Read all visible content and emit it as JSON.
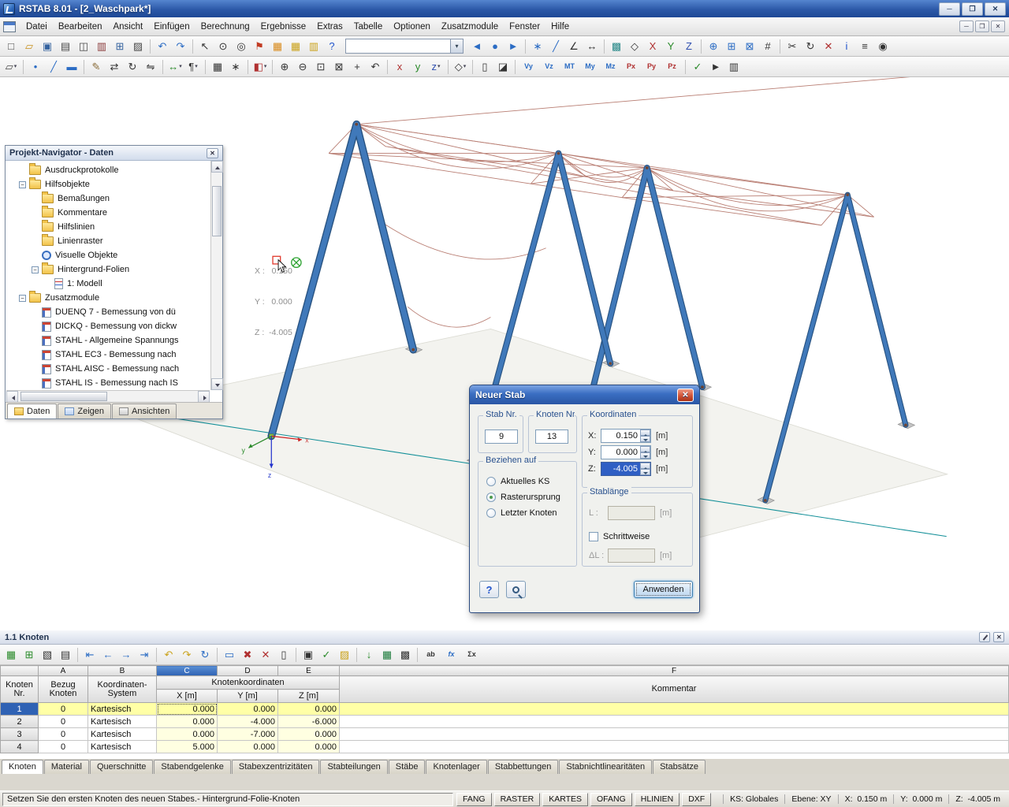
{
  "window": {
    "title": "RSTAB 8.01 - [2_Waschpark*]"
  },
  "menu": {
    "items": [
      "Datei",
      "Bearbeiten",
      "Ansicht",
      "Einfügen",
      "Berechnung",
      "Ergebnisse",
      "Extras",
      "Tabelle",
      "Optionen",
      "Zusatzmodule",
      "Fenster",
      "Hilfe"
    ]
  },
  "toolbar1": {
    "icons": [
      {
        "n": "new-file",
        "g": "□",
        "c": "#4a4a4a"
      },
      {
        "n": "open-project",
        "g": "▱",
        "c": "#c8901c"
      },
      {
        "n": "save",
        "g": "▣",
        "c": "#35639f"
      },
      {
        "n": "print",
        "g": "▤",
        "c": "#4a4a4a"
      },
      {
        "n": "print-preview",
        "g": "◫",
        "c": "#4a4a4a"
      },
      {
        "n": "export",
        "g": "▥",
        "c": "#8a3a3a"
      },
      {
        "n": "copy",
        "g": "⊞",
        "c": "#35639f"
      },
      {
        "n": "paste",
        "g": "▨",
        "c": "#4a4a4a"
      },
      {
        "t": "sep"
      },
      {
        "n": "undo",
        "g": "↶",
        "c": "#2b6cc4"
      },
      {
        "n": "redo",
        "g": "↷",
        "c": "#2b6cc4"
      },
      {
        "t": "sep"
      },
      {
        "n": "select-pointer",
        "g": "↖",
        "c": "#333333"
      },
      {
        "n": "zoom-region",
        "g": "⊙",
        "c": "#333333"
      },
      {
        "n": "magnifier",
        "g": "◎",
        "c": "#333333"
      },
      {
        "n": "flag-marker",
        "g": "⚑",
        "c": "#c23b22"
      },
      {
        "n": "project-navigator",
        "g": "▦",
        "c": "#d98a1a"
      },
      {
        "n": "table-manager",
        "g": "▦",
        "c": "#caa21a"
      },
      {
        "n": "mini-table",
        "g": "▥",
        "c": "#caa21a"
      },
      {
        "n": "help",
        "g": "?",
        "c": "#2255cc"
      },
      {
        "t": "combo"
      },
      {
        "n": "history-back",
        "g": "◄",
        "c": "#2b6cc4"
      },
      {
        "n": "history-current",
        "g": "●",
        "c": "#2b6cc4"
      },
      {
        "n": "history-forward",
        "g": "►",
        "c": "#2b6cc4"
      },
      {
        "t": "sep"
      },
      {
        "n": "insert-node",
        "g": "∗",
        "c": "#2b6cc4"
      },
      {
        "n": "insert-member",
        "g": "╱",
        "c": "#2b6cc4"
      },
      {
        "n": "coordinate-system",
        "g": "∠",
        "c": "#333333"
      },
      {
        "n": "measure",
        "g": "↔",
        "c": "#333333"
      },
      {
        "t": "sep"
      },
      {
        "n": "render-mode",
        "g": "▩",
        "c": "#2a8a8a"
      },
      {
        "n": "isometric-view",
        "g": "◇",
        "c": "#333333"
      },
      {
        "n": "view-x",
        "g": "X",
        "c": "#b03030"
      },
      {
        "n": "view-y",
        "g": "Y",
        "c": "#2a8a2a"
      },
      {
        "n": "view-z",
        "g": "Z",
        "c": "#3050b0"
      },
      {
        "t": "sep"
      },
      {
        "n": "model-check",
        "g": "⊕",
        "c": "#2b6cc4"
      },
      {
        "n": "load-cases",
        "g": "⊞",
        "c": "#2b6cc4"
      },
      {
        "n": "generators",
        "g": "⊠",
        "c": "#2b6cc4"
      },
      {
        "n": "numbering",
        "g": "#",
        "c": "#333333"
      },
      {
        "t": "sep"
      },
      {
        "n": "cut-section",
        "g": "✂",
        "c": "#333333"
      },
      {
        "n": "rotate-view",
        "g": "↻",
        "c": "#333333"
      },
      {
        "n": "delete",
        "g": "✕",
        "c": "#b03030"
      },
      {
        "n": "info",
        "g": "i",
        "c": "#2255cc"
      },
      {
        "n": "display-properties",
        "g": "≡",
        "c": "#333333"
      },
      {
        "n": "options",
        "g": "◉",
        "c": "#333333"
      }
    ]
  },
  "toolbar2": {
    "icons": [
      {
        "n": "new-member-mode",
        "g": "▱",
        "c": "#4a4a4a",
        "dd": true
      },
      {
        "t": "sep"
      },
      {
        "n": "new-node",
        "g": "•",
        "c": "#2b6cc4"
      },
      {
        "n": "new-line",
        "g": "╱",
        "c": "#2b6cc4"
      },
      {
        "n": "new-member",
        "g": "▬",
        "c": "#2b6cc4"
      },
      {
        "t": "sep"
      },
      {
        "n": "edit",
        "g": "✎",
        "c": "#8a6d3b"
      },
      {
        "n": "move-copy",
        "g": "⇄",
        "c": "#333333"
      },
      {
        "n": "rotate",
        "g": "↻",
        "c": "#333333"
      },
      {
        "n": "mirror",
        "g": "⇋",
        "c": "#333333"
      },
      {
        "t": "sep"
      },
      {
        "n": "dimension",
        "g": "↔",
        "c": "#2a8a2a",
        "dd": true
      },
      {
        "n": "comment",
        "g": "¶",
        "c": "#333333",
        "dd": true
      },
      {
        "t": "sep"
      },
      {
        "n": "grid",
        "g": "▦",
        "c": "#333333"
      },
      {
        "n": "snap",
        "g": "∗",
        "c": "#333333"
      },
      {
        "t": "sep"
      },
      {
        "n": "partial-view",
        "g": "◧",
        "c": "#b03030",
        "dd": true
      },
      {
        "t": "sep"
      },
      {
        "n": "zoom-in",
        "g": "⊕",
        "c": "#333333"
      },
      {
        "n": "zoom-out",
        "g": "⊖",
        "c": "#333333"
      },
      {
        "n": "zoom-window",
        "g": "⊡",
        "c": "#333333"
      },
      {
        "n": "zoom-all",
        "g": "⊠",
        "c": "#333333"
      },
      {
        "n": "pan",
        "g": "+",
        "c": "#333333"
      },
      {
        "n": "previous-view",
        "g": "↶",
        "c": "#333333"
      },
      {
        "t": "sep"
      },
      {
        "n": "axis-x",
        "g": "x",
        "c": "#b03030"
      },
      {
        "n": "axis-y",
        "g": "y",
        "c": "#2a8a2a"
      },
      {
        "n": "axis-z",
        "g": "z",
        "c": "#3050b0",
        "dd": true
      },
      {
        "t": "sep"
      },
      {
        "n": "projection",
        "g": "◇",
        "c": "#333333",
        "dd": true
      },
      {
        "t": "sep"
      },
      {
        "n": "section-box",
        "g": "▯",
        "c": "#333333"
      },
      {
        "n": "clipping",
        "g": "◪",
        "c": "#333333"
      },
      {
        "t": "sep"
      },
      {
        "n": "result-vy",
        "g": "Vy",
        "c": "#2b6cc4",
        "sm": true
      },
      {
        "n": "result-vz",
        "g": "Vz",
        "c": "#2b6cc4",
        "sm": true
      },
      {
        "n": "result-mt",
        "g": "MT",
        "c": "#2b6cc4",
        "sm": true
      },
      {
        "n": "result-my",
        "g": "My",
        "c": "#2b6cc4",
        "sm": true
      },
      {
        "n": "result-mz",
        "g": "Mz",
        "c": "#2b6cc4",
        "sm": true
      },
      {
        "n": "result-px",
        "g": "Px",
        "c": "#b03030",
        "sm": true
      },
      {
        "n": "result-py",
        "g": "Py",
        "c": "#b03030",
        "sm": true
      },
      {
        "n": "result-pz",
        "g": "Pz",
        "c": "#b03030",
        "sm": true
      },
      {
        "t": "sep"
      },
      {
        "n": "show-results",
        "g": "✓",
        "c": "#2a8a2a"
      },
      {
        "n": "animate",
        "g": "►",
        "c": "#333333"
      },
      {
        "n": "control-panel",
        "g": "▥",
        "c": "#333333"
      }
    ]
  },
  "navigator": {
    "title": "Projekt-Navigator - Daten",
    "tree": [
      {
        "label": "Ausdruckprotokolle",
        "depth": 1,
        "icon": "folder"
      },
      {
        "label": "Hilfsobjekte",
        "depth": 1,
        "icon": "folder",
        "expander": "minus"
      },
      {
        "label": "Bemaßungen",
        "depth": 2,
        "icon": "folder"
      },
      {
        "label": "Kommentare",
        "depth": 2,
        "icon": "folder"
      },
      {
        "label": "Hilfslinien",
        "depth": 2,
        "icon": "folder"
      },
      {
        "label": "Linienraster",
        "depth": 2,
        "icon": "folder"
      },
      {
        "label": "Visuelle Objekte",
        "depth": 2,
        "icon": "visual"
      },
      {
        "label": "Hintergrund-Folien",
        "depth": 2,
        "icon": "folder",
        "expander": "minus"
      },
      {
        "label": "1: Modell",
        "depth": 3,
        "icon": "dxf"
      },
      {
        "label": "Zusatzmodule",
        "depth": 1,
        "icon": "folder",
        "expander": "minus"
      },
      {
        "label": "DUENQ 7 - Bemessung von dü",
        "depth": 2,
        "icon": "module"
      },
      {
        "label": "DICKQ - Bemessung von dickw",
        "depth": 2,
        "icon": "module"
      },
      {
        "label": "STAHL - Allgemeine Spannungs",
        "depth": 2,
        "icon": "module"
      },
      {
        "label": "STAHL EC3 - Bemessung nach",
        "depth": 2,
        "icon": "module"
      },
      {
        "label": "STAHL AISC - Bemessung nach",
        "depth": 2,
        "icon": "module"
      },
      {
        "label": "STAHL IS - Bemessung nach IS",
        "depth": 2,
        "icon": "module"
      }
    ],
    "tabs": [
      {
        "label": "Daten",
        "active": true
      },
      {
        "label": "Zeigen",
        "active": false
      },
      {
        "label": "Ansichten",
        "active": false
      }
    ]
  },
  "viewport": {
    "coord_overlay": {
      "line1": "X :   0.150",
      "line2": "Y :   0.000",
      "line3": "Z :  -4.005"
    },
    "axis_labels": {
      "x": "x",
      "y": "y",
      "z": "z"
    }
  },
  "dialog": {
    "title": "Neuer Stab",
    "stab_nr": {
      "label": "Stab Nr.",
      "value": "9"
    },
    "knoten_nr": {
      "label": "Knoten Nr.",
      "value": "13"
    },
    "koordinaten": {
      "label": "Koordinaten",
      "unit": "[m]",
      "x": {
        "label": "X:",
        "value": "0.150"
      },
      "y": {
        "label": "Y:",
        "value": "0.000"
      },
      "z": {
        "label": "Z:",
        "value": "-4.005"
      }
    },
    "beziehen": {
      "label": "Beziehen auf",
      "options": [
        {
          "label": "Aktuelles KS",
          "checked": false
        },
        {
          "label": "Rasterursprung",
          "checked": true
        },
        {
          "label": "Letzter Knoten",
          "checked": false
        }
      ]
    },
    "stablaenge": {
      "label": "Stablänge",
      "l_label": "L :",
      "dl_label": "ΔL :",
      "unit": "[m]",
      "checkbox": "Schrittweise"
    },
    "apply_label": "Anwenden"
  },
  "table_panel": {
    "title": "1.1 Knoten",
    "letters": [
      "A",
      "B",
      "C",
      "D",
      "E",
      "F"
    ],
    "headers": {
      "col0": "Knoten Nr.",
      "a": "Bezug Knoten",
      "b": "Koordinaten- System",
      "cde": "Knotenkoordinaten",
      "x": "X [m]",
      "y": "Y [m]",
      "z": "Z [m]",
      "f": "Kommentar"
    },
    "rows": [
      {
        "nr": "1",
        "bezug": "0",
        "system": "Kartesisch",
        "x": "0.000",
        "y": "0.000",
        "z": "0.000",
        "comment": "",
        "selected": true
      },
      {
        "nr": "2",
        "bezug": "0",
        "system": "Kartesisch",
        "x": "0.000",
        "y": "-4.000",
        "z": "-6.000",
        "comment": "",
        "selected": false
      },
      {
        "nr": "3",
        "bezug": "0",
        "system": "Kartesisch",
        "x": "0.000",
        "y": "-7.000",
        "z": "0.000",
        "comment": "",
        "selected": false
      },
      {
        "nr": "4",
        "bezug": "0",
        "system": "Kartesisch",
        "x": "5.000",
        "y": "0.000",
        "z": "0.000",
        "comment": "",
        "selected": false
      }
    ],
    "tabs": [
      "Knoten",
      "Material",
      "Querschnitte",
      "Stabendgelenke",
      "Stabexzentrizitäten",
      "Stabteilungen",
      "Stäbe",
      "Knotenlager",
      "Stabbettungen",
      "Stabnichtlinearitäten",
      "Stabsätze"
    ],
    "toolbar": [
      {
        "n": "table-select",
        "g": "▦",
        "c": "#2a8a2a"
      },
      {
        "n": "table-properties",
        "g": "⊞",
        "c": "#2a8a2a"
      },
      {
        "n": "view-filter",
        "g": "▧",
        "c": "#333333"
      },
      {
        "n": "print-table",
        "g": "▤",
        "c": "#333333"
      },
      {
        "t": "sep"
      },
      {
        "n": "jump-first",
        "g": "⇤",
        "c": "#2b6cc4"
      },
      {
        "n": "jump-previous",
        "g": "←",
        "c": "#2b6cc4"
      },
      {
        "n": "jump-next",
        "g": "→",
        "c": "#2b6cc4"
      },
      {
        "n": "jump-last",
        "g": "⇥",
        "c": "#2b6cc4"
      },
      {
        "t": "sep"
      },
      {
        "n": "undo",
        "g": "↶",
        "c": "#caa21a"
      },
      {
        "n": "redo",
        "g": "↷",
        "c": "#caa21a"
      },
      {
        "n": "refresh",
        "g": "↻",
        "c": "#2b6cc4"
      },
      {
        "t": "sep"
      },
      {
        "n": "insert-row",
        "g": "▭",
        "c": "#2b6cc4"
      },
      {
        "n": "delete-row",
        "g": "✖",
        "c": "#b03030"
      },
      {
        "n": "cut-row",
        "g": "✕",
        "c": "#b03030"
      },
      {
        "n": "empty-row",
        "g": "▯",
        "c": "#333333"
      },
      {
        "t": "sep"
      },
      {
        "n": "view-mode",
        "g": "▣",
        "c": "#333333"
      },
      {
        "n": "check-plausibility",
        "g": "✓",
        "c": "#2a8a2a"
      },
      {
        "n": "notes",
        "g": "▨",
        "c": "#caa21a"
      },
      {
        "t": "sep"
      },
      {
        "n": "import-table",
        "g": "↓",
        "c": "#2a8a2a"
      },
      {
        "n": "export-excel",
        "g": "▦",
        "c": "#1a7a3a"
      },
      {
        "n": "calculator",
        "g": "▩",
        "c": "#333333"
      },
      {
        "t": "sep"
      },
      {
        "n": "find-replace",
        "g": "ab",
        "c": "#333333",
        "sm": true
      },
      {
        "n": "function-editor",
        "g": "fx",
        "c": "#2b6cc4",
        "sm": true,
        "it": true
      },
      {
        "n": "formula",
        "g": "Σx",
        "c": "#333333",
        "sm": true
      }
    ]
  },
  "statusbar": {
    "message": "Setzen Sie den ersten Knoten des neuen Stabes.- Hintergrund-Folie-Knoten",
    "toggles": [
      "FANG",
      "RASTER",
      "KARTES",
      "OFANG",
      "HLINIEN",
      "DXF"
    ],
    "right": [
      "KS: Globales",
      "Ebene: XY",
      "X:  0.150 m",
      "Y:  0.000 m",
      "Z:  -4.005 m"
    ]
  }
}
